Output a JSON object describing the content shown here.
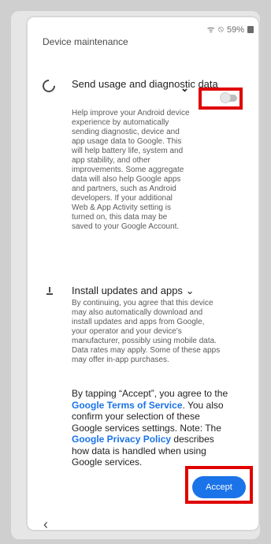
{
  "status": {
    "wifi": "ᯤ",
    "dnd": "⦸",
    "battery": "59%"
  },
  "screen_title": "Device maintenance",
  "usage": {
    "title": "Send usage and diagnostic data",
    "description": "Help improve your Android device experience by automatically sending diagnostic, device and app usage data to Google. This will help battery life, system and app stability, and other improvements. Some aggregate data will also help Google apps and partners, such as Android developers. If your additional Web & App Activity setting is turned on, this data may be saved to your Google Account.",
    "toggle_on": false
  },
  "updates": {
    "title": "Install updates and apps",
    "description": "By continuing, you agree that this device may also automatically download and install updates and apps from Google, your operator and your device's manufacturer, possibly using mobile data. Data rates may apply. Some of these apps may offer in-app purchases."
  },
  "consent": {
    "p1": "By tapping “Accept”, you agree to the ",
    "terms": "Google Terms of Service",
    "p2": ". You also confirm your selection of these Google services settings. Note: The ",
    "privacy": "Google Privacy Policy",
    "p3": " describes how data is handled when using Google services."
  },
  "accept_label": "Accept",
  "back_glyph": "‹",
  "highlight_color": "#e00000",
  "accent_color": "#1a73e8"
}
